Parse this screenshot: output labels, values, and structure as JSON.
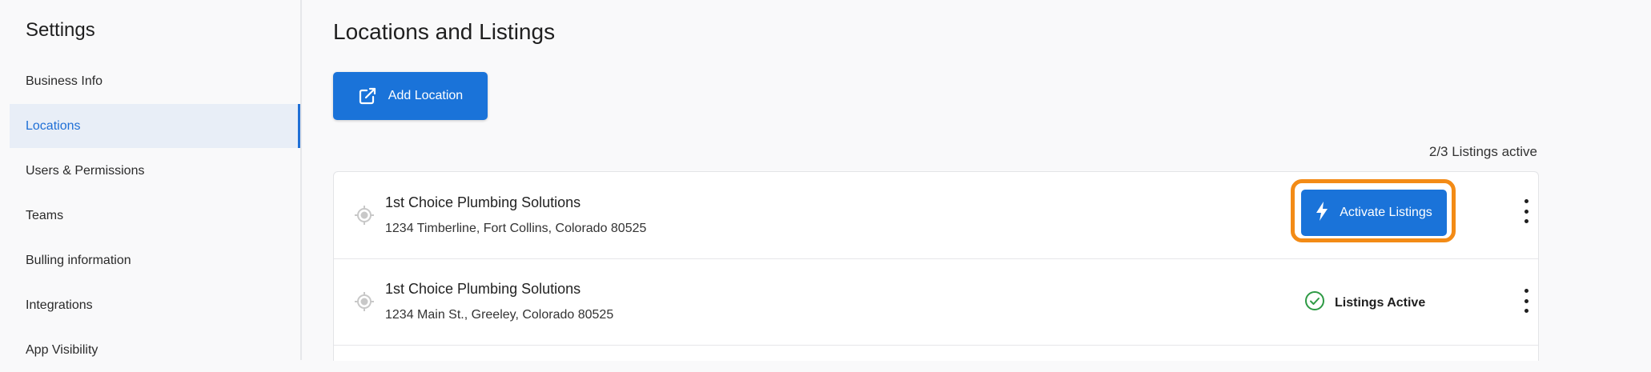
{
  "sidebar": {
    "title": "Settings",
    "items": [
      {
        "label": "Business Info"
      },
      {
        "label": "Locations"
      },
      {
        "label": "Users & Permissions"
      },
      {
        "label": "Teams"
      },
      {
        "label": "Bulling  information"
      },
      {
        "label": "Integrations"
      },
      {
        "label": "App Visibility"
      }
    ],
    "active_index": 1
  },
  "main": {
    "title": "Locations and Listings",
    "add_button_label": "Add Location",
    "listing_count": "2/3 Listings active",
    "locations": [
      {
        "name": "1st Choice Plumbing Solutions",
        "address": "1234 Timberline, Fort Collins, Colorado 80525",
        "action_label": "Activate Listings"
      },
      {
        "name": "1st Choice Plumbing Solutions",
        "address": "1234 Main St., Greeley, Colorado 80525",
        "status_label": "Listings Active"
      }
    ]
  },
  "colors": {
    "accent": "#1a73d9",
    "highlight": "#f38b16",
    "success": "#2e9a45",
    "active_nav_bg": "#e8eef7"
  },
  "icons": {
    "add": "external-link-icon",
    "location": "location-target-icon",
    "activate": "lightning-bolt-icon",
    "status": "check-circle-icon",
    "menu": "kebab-menu-icon"
  }
}
